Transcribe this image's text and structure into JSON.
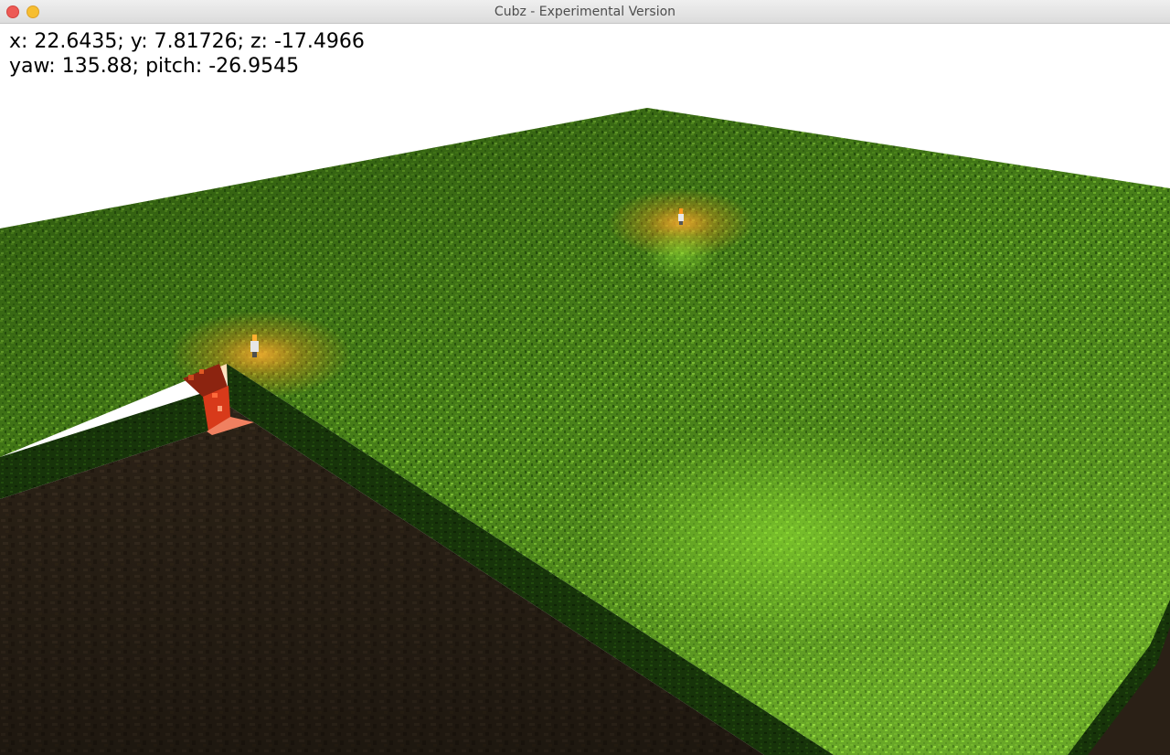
{
  "window": {
    "title": "Cubz - Experimental Version",
    "close_icon": "close-circle",
    "minimize_icon": "minimize-circle"
  },
  "hud": {
    "position_readout": "x: 22.6435; y: 7.81726; z: -17.4966",
    "orientation_readout": "yaw: 135.88; pitch: -26.9545"
  },
  "scene": {
    "sky_color": "#ffffff",
    "grass_color": "#4f8a1c",
    "grass_bright_color": "#7fc633",
    "grass_dark_color": "#264c0c",
    "dirt_color": "#2e2418",
    "wall_top_color": "#153008",
    "torch_glow_color": "#ff9a1e",
    "fire_block_color": "#c0301a",
    "objects": [
      "torch",
      "torch",
      "fire-block"
    ]
  }
}
